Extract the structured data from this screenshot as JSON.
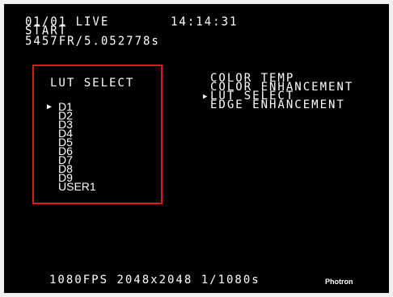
{
  "status": {
    "line1": "01/01 LIVE",
    "line2": "START",
    "line3": "5457FR/5.052778s",
    "clock": "14:14:31"
  },
  "lut_select": {
    "title": "LUT SELECT",
    "cursor": "▶",
    "items": [
      "D1",
      "D2",
      "D3",
      "D4",
      "D5",
      "D6",
      "D7",
      "D8",
      "D9",
      "USER1"
    ],
    "selected": "D1",
    "border_color": "#e01a1a"
  },
  "menu": {
    "cursor": "▶",
    "items": [
      "COLOR TEMP",
      "COLOR ENHANCEMENT",
      "LUT SELECT",
      "EDGE ENHANCEMENT"
    ],
    "selected": "LUT SELECT"
  },
  "footer": {
    "info": "1080FPS 2048x2048 1/1080s",
    "brand": "Photron"
  }
}
